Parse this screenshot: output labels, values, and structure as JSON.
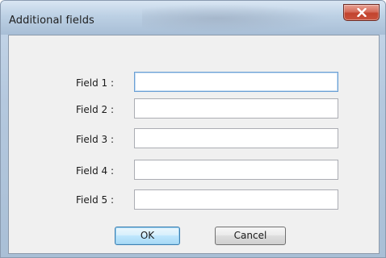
{
  "window": {
    "title": "Additional fields",
    "close_icon": "close-icon"
  },
  "form": {
    "fields": [
      {
        "label": "Field 1 :",
        "value": ""
      },
      {
        "label": "Field 2 :",
        "value": ""
      },
      {
        "label": "Field 3 :",
        "value": ""
      },
      {
        "label": "Field 4 :",
        "value": ""
      },
      {
        "label": "Field 5 :",
        "value": ""
      }
    ]
  },
  "buttons": {
    "ok_label": "OK",
    "cancel_label": "Cancel"
  },
  "colors": {
    "close_button": "#c7432e",
    "focus_border": "#6a9fd4",
    "client_bg": "#f0f0f0"
  }
}
